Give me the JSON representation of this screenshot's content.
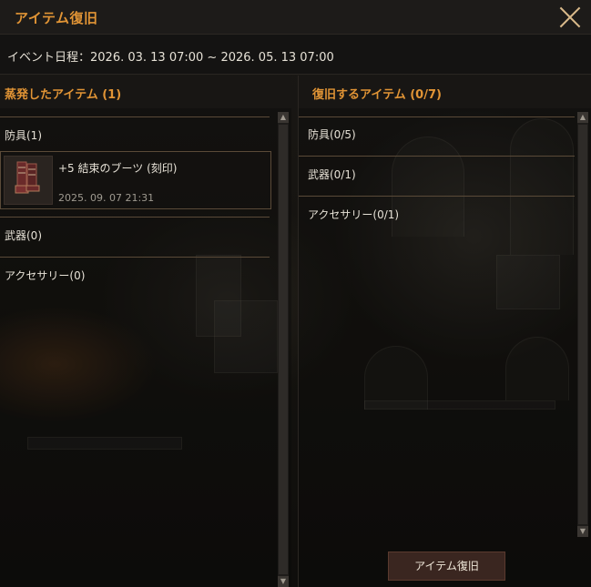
{
  "window": {
    "title": "アイテム復旧"
  },
  "event": {
    "schedule": "イベント日程：2026. 03. 13 07:00 ~ 2026. 05. 13 07:00"
  },
  "left_panel": {
    "header": "蒸発したアイテム (1)",
    "categories": [
      {
        "label": "防具(1)"
      },
      {
        "label": "武器(0)"
      },
      {
        "label": "アクセサリー(0)"
      }
    ],
    "items": [
      {
        "name": "+5 結束のブーツ (刻印)",
        "date": "2025. 09. 07 21:31",
        "icon": "boots-icon"
      }
    ]
  },
  "right_panel": {
    "header": "復旧するアイテム (0/7)",
    "categories": [
      {
        "label": "防具(0/5)"
      },
      {
        "label": "武器(0/1)"
      },
      {
        "label": "アクセサリー(0/1)"
      }
    ]
  },
  "actions": {
    "restore_button": "アイテム復旧"
  },
  "colors": {
    "accent": "#e19435",
    "divider": "#5a4a38",
    "button_bg": "#3a2620"
  }
}
